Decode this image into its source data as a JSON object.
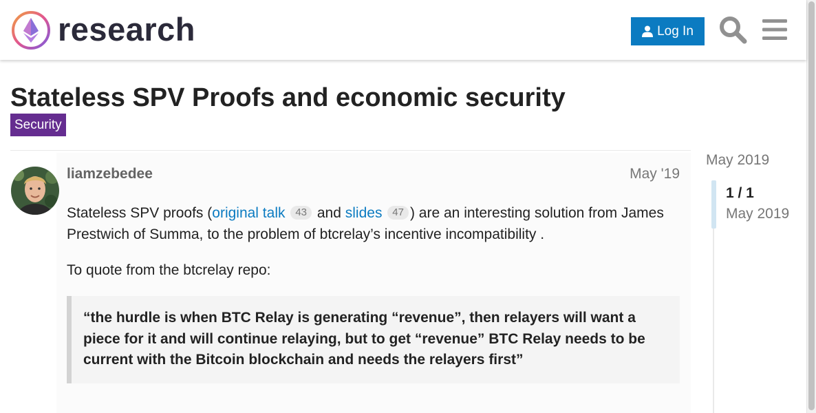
{
  "header": {
    "logo_text": "research",
    "login_label": "Log In",
    "search_icon": "search-icon",
    "menu_icon": "hamburger-menu-icon"
  },
  "topic": {
    "title": "Stateless SPV Proofs and economic security",
    "category": "Security",
    "category_color": "#652d90"
  },
  "post": {
    "username": "liamzebedee",
    "date": "May '19",
    "p1_before": "Stateless SPV proofs (",
    "link1": "original talk",
    "link1_clicks": "43",
    "p1_and": " and ",
    "link2": "slides",
    "link2_clicks": "47",
    "p1_after": ") are an interesting solution from James Prestwich of Summa, to the problem of btcrelay’s incentive incompatibility .",
    "p2": "To quote from the btcrelay repo:",
    "quote": "“the hurdle is when BTC Relay is generating “revenue”, then relayers will want a piece for it and will continue relaying, but to get “revenue” BTC Relay needs to be current with the Bitcoin blockchain and needs the relayers first”"
  },
  "timeline": {
    "start_date": "May 2019",
    "position": "1 / 1",
    "current_date": "May 2019"
  },
  "colors": {
    "accent": "#0b7bc1",
    "category": "#652d90"
  }
}
